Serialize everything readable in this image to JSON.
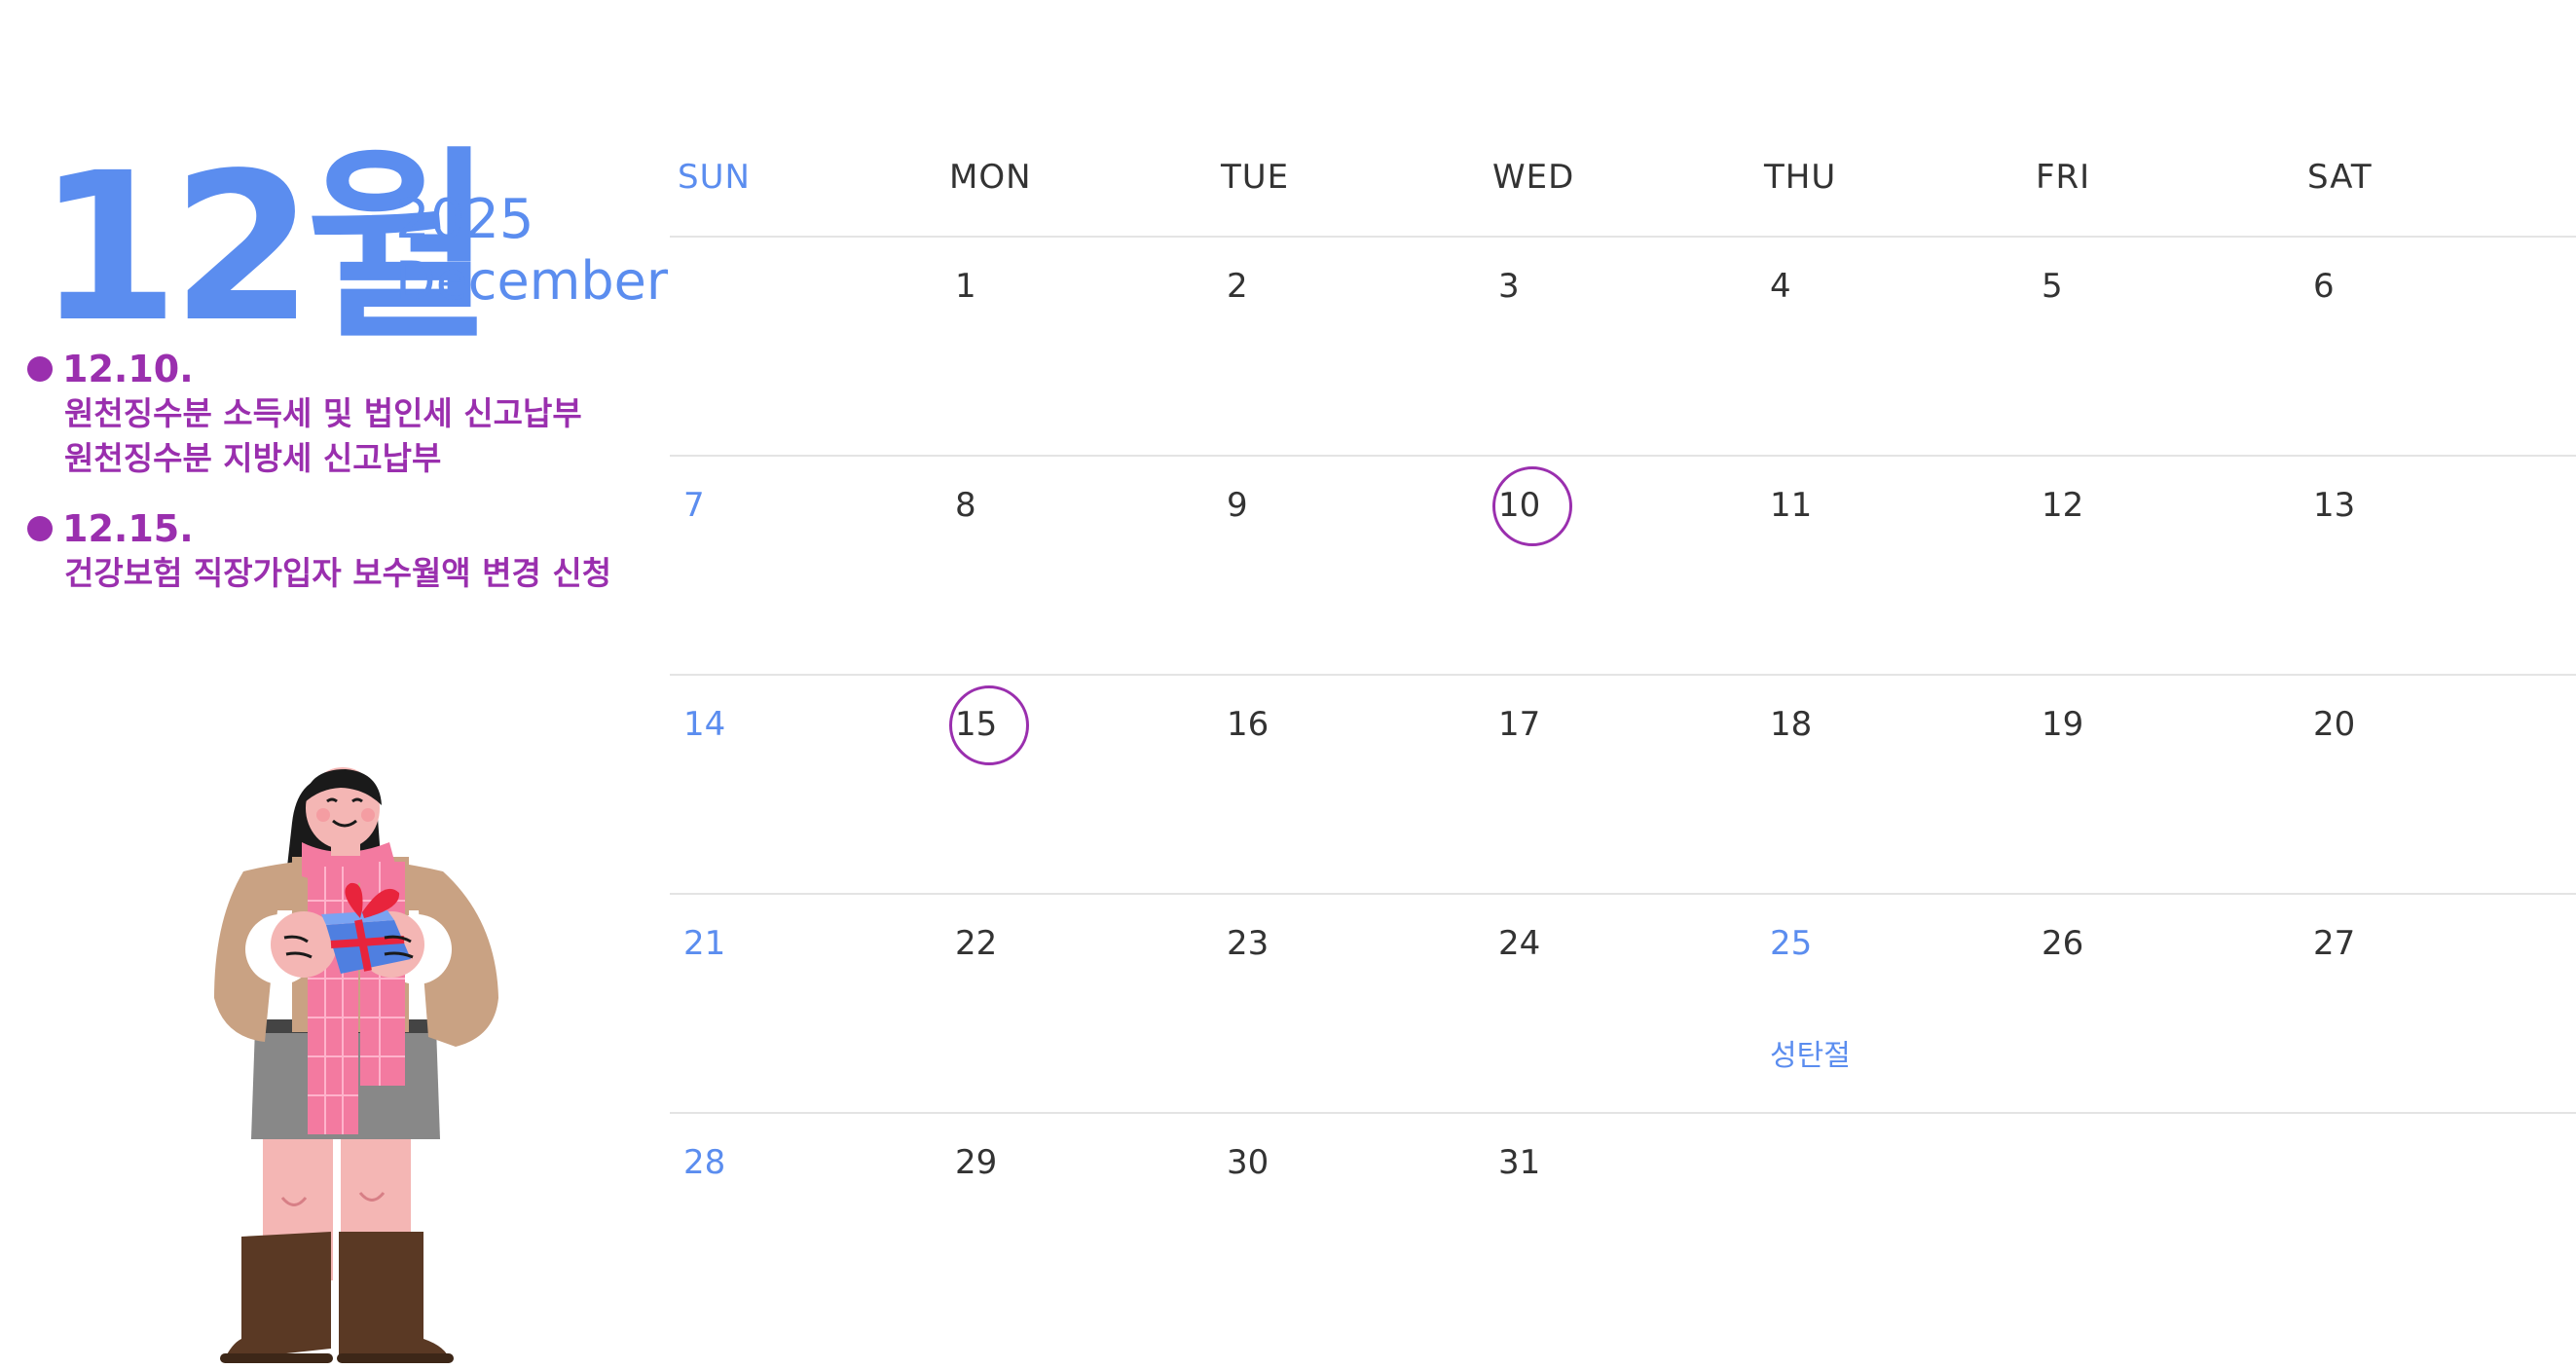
{
  "header": {
    "month_big": "12월",
    "year": "2025",
    "month_en": "December"
  },
  "events": [
    {
      "date": "12.10.",
      "lines": [
        "원천징수분 소득세 및 법인세 신고납부",
        "원천징수분 지방세 신고납부"
      ]
    },
    {
      "date": "12.15.",
      "lines": [
        "건강보험 직장가입자 보수월액 변경 신청"
      ]
    }
  ],
  "calendar": {
    "weekdays": [
      "SUN",
      "MON",
      "TUE",
      "WED",
      "THU",
      "FRI",
      "SAT"
    ],
    "weeks": [
      [
        "",
        "1",
        "2",
        "3",
        "4",
        "5",
        "6"
      ],
      [
        "7",
        "8",
        "9",
        "10",
        "11",
        "12",
        "13"
      ],
      [
        "14",
        "15",
        "16",
        "17",
        "18",
        "19",
        "20"
      ],
      [
        "21",
        "22",
        "23",
        "24",
        "25",
        "26",
        "27"
      ],
      [
        "28",
        "29",
        "30",
        "31",
        "",
        "",
        ""
      ]
    ],
    "marked_days": [
      "10",
      "15"
    ],
    "holidays": [
      {
        "day": "25",
        "label": "성탄절"
      }
    ]
  },
  "colors": {
    "accent_blue": "#5b8def",
    "accent_purple": "#9a2fae",
    "text": "#333333",
    "grid_line": "#e4e4e4"
  },
  "illustration": {
    "icon": "woman-holding-gift-illustration"
  }
}
